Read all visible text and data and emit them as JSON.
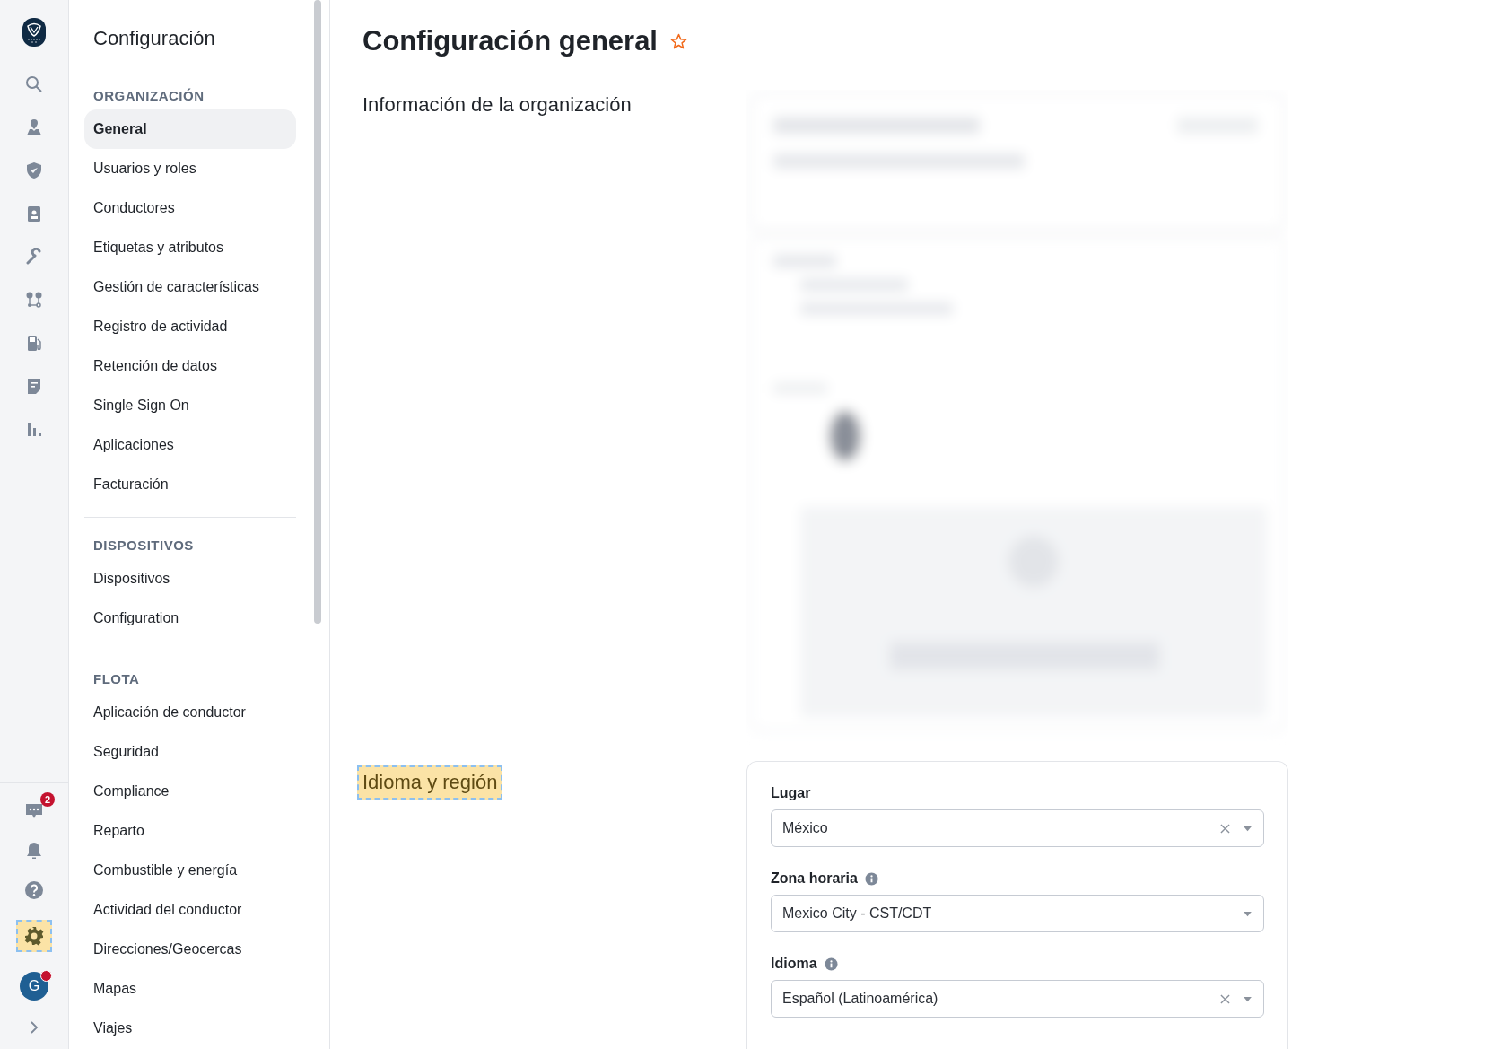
{
  "rail": {
    "chat_badge": "2",
    "avatar_initial": "G",
    "settings_highlighted": true
  },
  "sidebar": {
    "title": "Configuración",
    "sections": [
      {
        "heading": "ORGANIZACIÓN",
        "items": [
          {
            "label": "General",
            "selected": true
          },
          {
            "label": "Usuarios y roles",
            "selected": false
          },
          {
            "label": "Conductores",
            "selected": false
          },
          {
            "label": "Etiquetas y atributos",
            "selected": false
          },
          {
            "label": "Gestión de características",
            "selected": false
          },
          {
            "label": "Registro de actividad",
            "selected": false
          },
          {
            "label": "Retención de datos",
            "selected": false
          },
          {
            "label": "Single Sign On",
            "selected": false
          },
          {
            "label": "Aplicaciones",
            "selected": false
          },
          {
            "label": "Facturación",
            "selected": false
          }
        ]
      },
      {
        "heading": "DISPOSITIVOS",
        "items": [
          {
            "label": "Dispositivos",
            "selected": false
          },
          {
            "label": "Configuration",
            "selected": false
          }
        ]
      },
      {
        "heading": "FLOTA",
        "items": [
          {
            "label": "Aplicación de conductor",
            "selected": false
          },
          {
            "label": "Seguridad",
            "selected": false
          },
          {
            "label": "Compliance",
            "selected": false
          },
          {
            "label": "Reparto",
            "selected": false
          },
          {
            "label": "Combustible y energía",
            "selected": false
          },
          {
            "label": "Actividad del conductor",
            "selected": false
          },
          {
            "label": "Direcciones/Geocercas",
            "selected": false
          },
          {
            "label": "Mapas",
            "selected": false
          },
          {
            "label": "Viajes",
            "selected": false
          }
        ]
      }
    ]
  },
  "page": {
    "title": "Configuración general",
    "favorite": false
  },
  "sections": [
    {
      "heading": "Información de la organización",
      "highlighted": false,
      "kind": "blurred"
    },
    {
      "heading": "Idioma y región",
      "highlighted": true,
      "kind": "form",
      "fields": [
        {
          "label": "Lugar",
          "info": false,
          "value": "México",
          "clearable": true
        },
        {
          "label": "Zona horaria",
          "info": true,
          "value": "Mexico City - CST/CDT",
          "clearable": false
        },
        {
          "label": "Idioma",
          "info": true,
          "value": "Español (Latinoamérica)",
          "clearable": true
        }
      ]
    }
  ]
}
